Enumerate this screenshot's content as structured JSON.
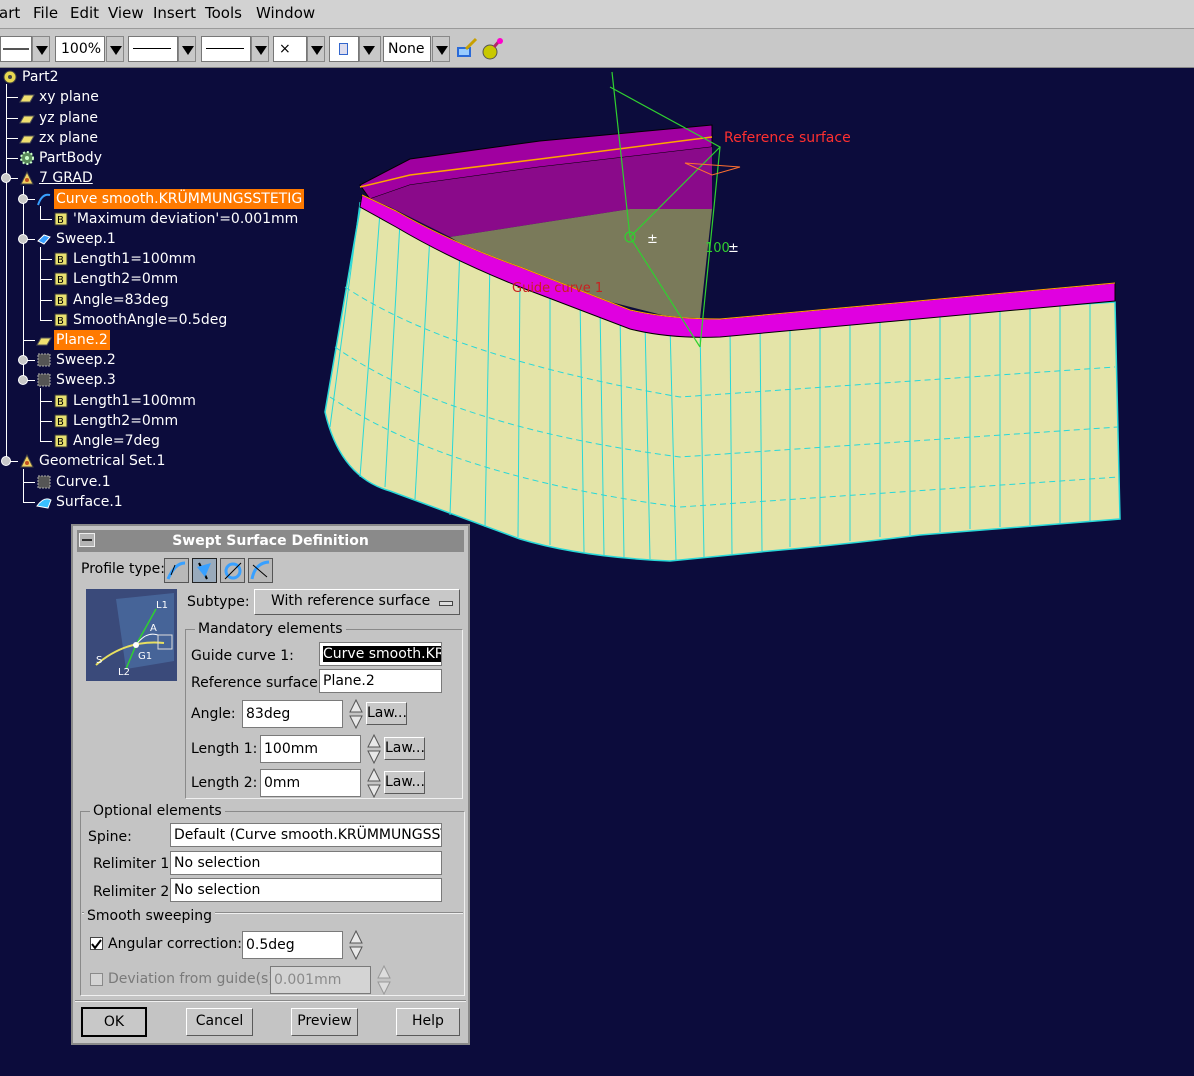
{
  "menu": {
    "items": [
      "Start",
      "File",
      "Edit",
      "View",
      "Insert",
      "Tools",
      "Window"
    ],
    "start_visible": "art"
  },
  "toolbar": {
    "zoom": "100%",
    "symbol": "×",
    "layer": "None"
  },
  "tree": {
    "root": "Part2",
    "xy_plane": "xy plane",
    "yz_plane": "yz plane",
    "zx_plane": "zx plane",
    "partbody": "PartBody",
    "set_7grad": "7 GRAD",
    "curve_smooth": "Curve smooth.KRÜMMUNGSSTETIG",
    "max_dev": "'Maximum deviation'=0.001mm",
    "sweep1": "Sweep.1",
    "s1_length1": "Length1=100mm",
    "s1_length2": "Length2=0mm",
    "s1_angle": "Angle=83deg",
    "s1_smooth": "SmoothAngle=0.5deg",
    "plane2": "Plane.2",
    "sweep2": "Sweep.2",
    "sweep3": "Sweep.3",
    "s3_length1": "Length1=100mm",
    "s3_length2": "Length2=0mm",
    "s3_angle": "Angle=7deg",
    "geoset1": "Geometrical Set.1",
    "curve1": "Curve.1",
    "surface1": "Surface.1"
  },
  "viewport": {
    "ref_surface_label": "Reference surface",
    "guide_curve_label": "Guide curve 1",
    "len_label": "100",
    "pm": "±"
  },
  "dialog": {
    "title": "Swept Surface Definition",
    "profile_type_label": "Profile type:",
    "subtype_label": "Subtype:",
    "subtype_value": "With reference surface",
    "mandatory_title": "Mandatory elements",
    "guide_curve_label": "Guide curve 1:",
    "guide_curve_value": "Curve smooth.KRÜ",
    "ref_surface_label": "Reference surface:",
    "ref_surface_value": "Plane.2",
    "angle_label": "Angle:",
    "angle_value": "83deg",
    "length1_label": "Length 1:",
    "length1_value": "100mm",
    "length2_label": "Length 2:",
    "length2_value": "0mm",
    "law_label": "Law...",
    "optional_title": "Optional elements",
    "spine_label": "Spine:",
    "spine_value": "Default (Curve smooth.KRÜMMUNGSSTE",
    "relimiter1_label": "Relimiter 1:",
    "relimiter1_value": "No selection",
    "relimiter2_label": "Relimiter 2:",
    "relimiter2_value": "No selection",
    "smooth_title": "Smooth sweeping",
    "angular_label": "Angular correction:",
    "angular_value": "0.5deg",
    "angular_checked": true,
    "deviation_label": "Deviation from guide(s):",
    "deviation_value": "0.001mm",
    "deviation_checked": false,
    "ok": "OK",
    "cancel": "Cancel",
    "preview": "Preview",
    "help": "Help",
    "diagram": {
      "l1": "L1",
      "a": "A",
      "g1": "G1",
      "s": "S",
      "l2": "L2"
    }
  }
}
